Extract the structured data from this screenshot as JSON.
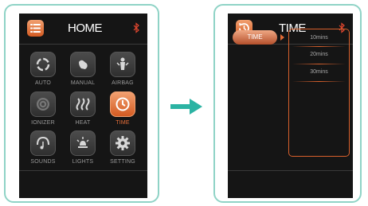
{
  "home": {
    "title": "HOME",
    "items": [
      {
        "label": "AUTO",
        "icon": "auto-cycle-icon",
        "active": false
      },
      {
        "label": "MANUAL",
        "icon": "hand-icon",
        "active": false
      },
      {
        "label": "AIRBAG",
        "icon": "airbag-body-icon",
        "active": false
      },
      {
        "label": "IONIZER",
        "icon": "ionizer-icon",
        "active": false
      },
      {
        "label": "HEAT",
        "icon": "heat-waves-icon",
        "active": false
      },
      {
        "label": "TIME",
        "icon": "clock-icon",
        "active": true
      },
      {
        "label": "SOUNDS",
        "icon": "music-note-icon",
        "active": false
      },
      {
        "label": "LIGHTS",
        "icon": "light-icon",
        "active": false
      },
      {
        "label": "SETTING",
        "icon": "gear-icon",
        "active": false
      }
    ]
  },
  "time": {
    "title": "TIME",
    "selected": "TIME",
    "options": [
      "10mins",
      "20mins",
      "30mins"
    ]
  },
  "colors": {
    "accent": "#e36b35",
    "frame": "#8fd3c6",
    "screen": "#151515"
  }
}
